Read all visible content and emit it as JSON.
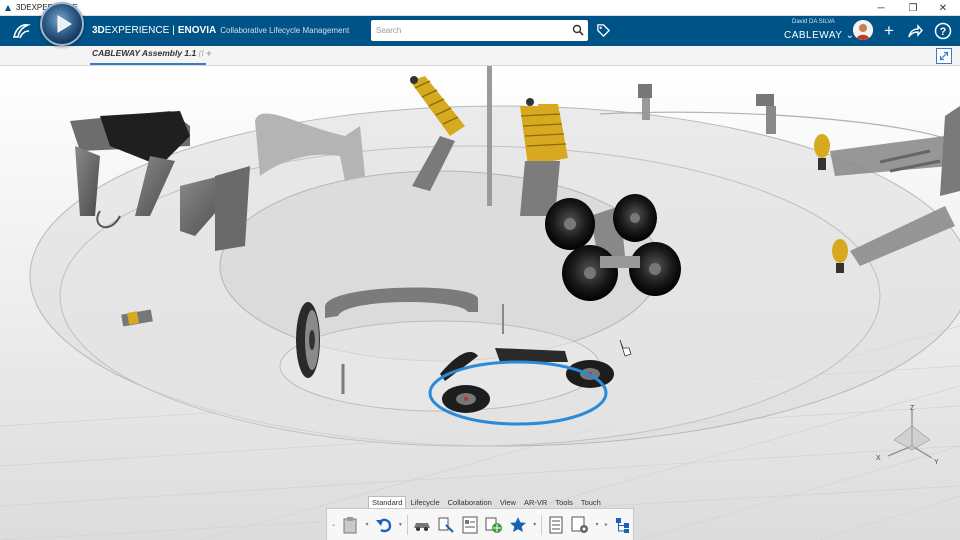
{
  "os_window": {
    "title": "3DEXPERIENCE",
    "minimize": "─",
    "maximize": "❐",
    "close": "✕"
  },
  "header": {
    "brand_3d": "3D",
    "brand_experience": "EXPERIENCE",
    "brand_separator": "|",
    "brand_app": "ENOVIA",
    "brand_subtitle": "Collaborative Lifecycle Management",
    "search_placeholder": "Search",
    "user_name": "David DA SILVA",
    "tenant": "CABLEWAY",
    "tenant_caret": "⌄",
    "add_symbol": "+",
    "help_symbol": "?",
    "accent_color": "#005386"
  },
  "document_tab": {
    "title": "CABLEWAY Assembly 1.1",
    "truncation": "(t",
    "add": "+"
  },
  "compass_axes": {
    "x": "X",
    "y": "Y",
    "z": "Z"
  },
  "action_bar": {
    "tabs": [
      "Standard",
      "Lifecycle",
      "Collaboration",
      "View",
      "AR-VR",
      "Tools",
      "Touch"
    ],
    "active_tab": "Standard",
    "tools": [
      "clipboard-icon",
      "undo-icon",
      "car-part-icon",
      "replace-icon",
      "properties-icon",
      "globe-icon",
      "favorite-star-icon",
      "list-icon",
      "settings-list-icon",
      "tree-icon"
    ]
  }
}
